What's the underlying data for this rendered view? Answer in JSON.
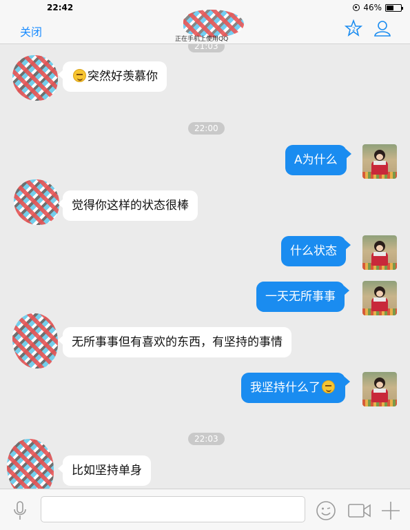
{
  "status_bar": {
    "time": "22:42",
    "battery": "46%"
  },
  "nav": {
    "close_label": "关闭",
    "contact_status": "正在手机上使用QQ",
    "accent_color": "#1a8cf0"
  },
  "messages": [
    {
      "type": "timestamp",
      "text": "21:03"
    },
    {
      "type": "in",
      "text": "突然好羡慕你",
      "emoji": "smirk-emoji"
    },
    {
      "type": "timestamp",
      "text": "22:00"
    },
    {
      "type": "out",
      "text": "A为什么"
    },
    {
      "type": "in",
      "text": "觉得你这样的状态很棒"
    },
    {
      "type": "out",
      "text": "什么状态"
    },
    {
      "type": "out",
      "text": "一天无所事事"
    },
    {
      "type": "in",
      "text": "无所事事但有喜欢的东西，有坚持的事情"
    },
    {
      "type": "out",
      "text": "我坚持什么了",
      "emoji": "tears-of-joy-emoji"
    },
    {
      "type": "timestamp",
      "text": "22:03"
    },
    {
      "type": "in",
      "text": "比如坚持单身"
    }
  ],
  "input": {
    "placeholder": "",
    "icons": [
      "microphone-icon",
      "emoji-icon",
      "video-icon",
      "plus-icon"
    ]
  }
}
